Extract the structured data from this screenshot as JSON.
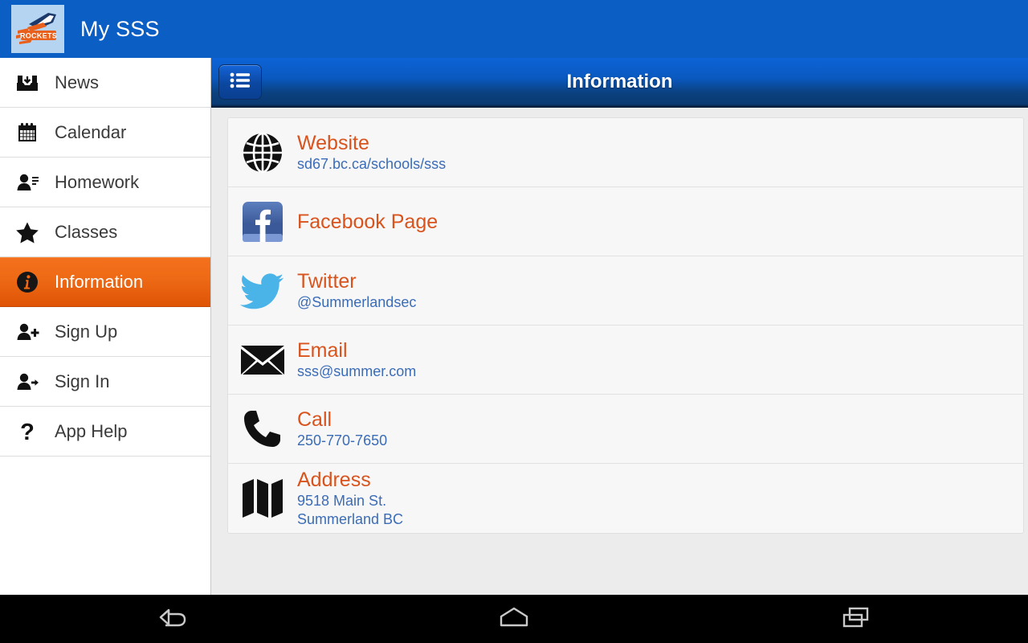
{
  "appbar": {
    "title": "My SSS",
    "logo_alt": "Rockets",
    "logo_text": "ROCKETS",
    "background": "#0b5ec4"
  },
  "sidebar": {
    "items": [
      {
        "label": "News",
        "icon": "inbox-icon",
        "active": false
      },
      {
        "label": "Calendar",
        "icon": "calendar-icon",
        "active": false
      },
      {
        "label": "Homework",
        "icon": "person-lines-icon",
        "active": false
      },
      {
        "label": "Classes",
        "icon": "star-icon",
        "active": false
      },
      {
        "label": "Information",
        "icon": "info-circle-icon",
        "active": true
      },
      {
        "label": "Sign Up",
        "icon": "person-add-icon",
        "active": false
      },
      {
        "label": "Sign In",
        "icon": "person-arrow-icon",
        "active": false
      },
      {
        "label": "App Help",
        "icon": "question-mark-icon",
        "active": false
      }
    ],
    "active_color": "#ee6a15"
  },
  "content": {
    "header": {
      "title": "Information",
      "menu_button_icon": "list-menu-icon"
    },
    "rows": [
      {
        "title": "Website",
        "sub": "sd67.bc.ca/schools/sss",
        "sub2": "",
        "icon": "globe-icon"
      },
      {
        "title": "Facebook Page",
        "sub": "",
        "sub2": "",
        "icon": "facebook-icon"
      },
      {
        "title": "Twitter",
        "sub": "@Summerlandsec",
        "sub2": "",
        "icon": "twitter-bird-icon"
      },
      {
        "title": "Email",
        "sub": "sss@summer.com",
        "sub2": "",
        "icon": "envelope-icon"
      },
      {
        "title": "Call",
        "sub": "250-770-7650",
        "sub2": "",
        "icon": "phone-icon"
      },
      {
        "title": "Address",
        "sub": "9518 Main St.",
        "sub2": "Summerland BC",
        "icon": "map-icon"
      }
    ],
    "title_color": "#d9531d",
    "sub_color": "#3b6cb8"
  },
  "sysnav": {
    "buttons": [
      {
        "name": "back",
        "icon": "back-arrow-icon"
      },
      {
        "name": "home",
        "icon": "home-icon"
      },
      {
        "name": "recents",
        "icon": "recents-icon"
      }
    ]
  }
}
